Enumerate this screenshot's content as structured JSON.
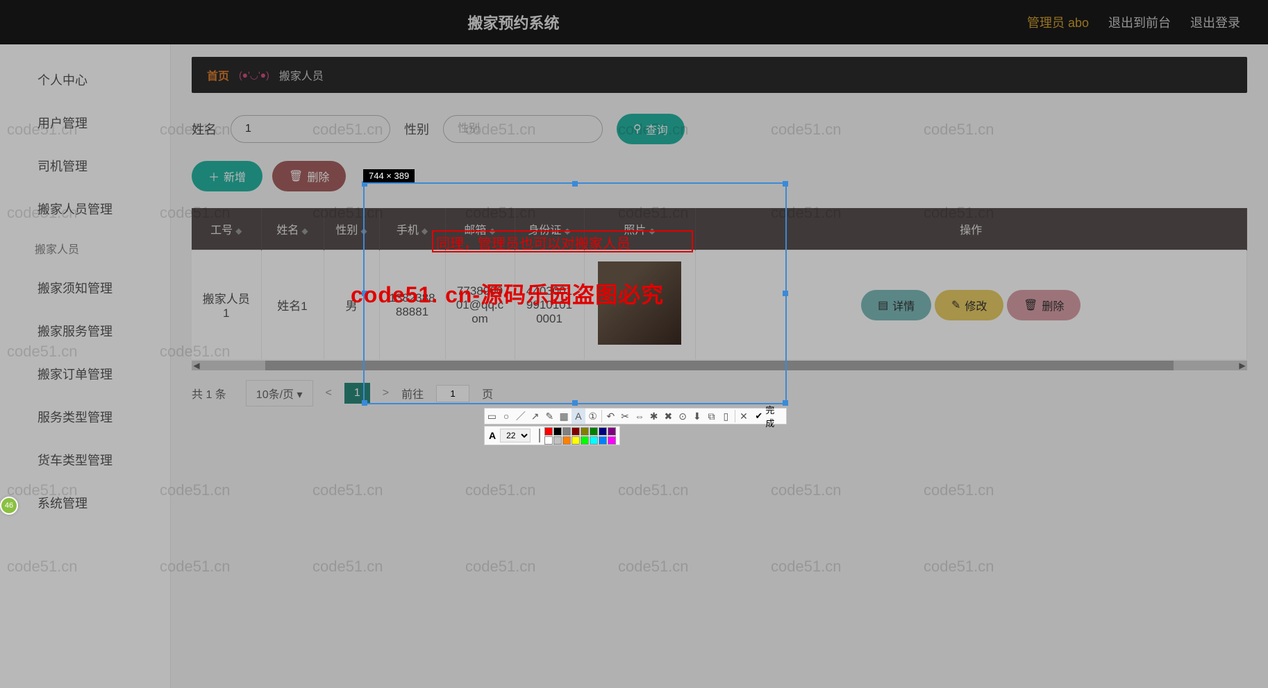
{
  "topbar": {
    "title": "搬家预约系统",
    "admin_label": "管理员 abo",
    "front_label": "退出到前台",
    "logout_label": "退出登录"
  },
  "sidebar": {
    "items": [
      {
        "label": "个人中心"
      },
      {
        "label": "用户管理"
      },
      {
        "label": "司机管理"
      },
      {
        "label": "搬家人员管理"
      },
      {
        "label": "搬家须知管理"
      },
      {
        "label": "搬家服务管理"
      },
      {
        "label": "搬家订单管理"
      },
      {
        "label": "服务类型管理"
      },
      {
        "label": "货车类型管理"
      },
      {
        "label": "系统管理"
      }
    ],
    "sub_label": "搬家人员"
  },
  "breadcrumb": {
    "home": "首页",
    "face": "(●'◡'●)",
    "current": "搬家人员"
  },
  "filter": {
    "name_label": "姓名",
    "name_value": "1",
    "gender_label": "性别",
    "gender_placeholder": "性别",
    "search_label": "查询"
  },
  "actions": {
    "add_label": "新增",
    "delete_label": "删除"
  },
  "table": {
    "headers": [
      "工号",
      "姓名",
      "性别",
      "手机",
      "邮箱",
      "身份证",
      "照片",
      "操作"
    ],
    "rows": [
      {
        "id": "搬家人员1",
        "name": "姓名1",
        "gender": "男",
        "phone": "138238888881",
        "email": "773890001@qq.com",
        "idcard": "440300199101010001",
        "detail_label": "详情",
        "edit_label": "修改",
        "delete_label": "删除"
      }
    ]
  },
  "pager": {
    "total_text": "共 1 条",
    "page_size_text": "10条/页",
    "prev": "<",
    "page": "1",
    "next": ">",
    "goto_text": "前往",
    "page_suffix": "页",
    "goto_value": "1"
  },
  "screenshot": {
    "dim_label": "744 × 389",
    "annotation1": "同理，管理员也可以对搬家人员",
    "annotation2": "code51. cn-源码乐园盗图必究",
    "done_label": "完成",
    "font_size": "22"
  },
  "watermark_text": "code51.cn",
  "badge": "46",
  "colors": {
    "palette": [
      "#ff0000",
      "#000000",
      "#808080",
      "#800000",
      "#808000",
      "#008000",
      "#000080",
      "#800080",
      "#ffffff",
      "#c0c0c0",
      "#ff8000",
      "#ffff00",
      "#00ff00",
      "#00ffff",
      "#0080ff",
      "#ff00ff"
    ]
  }
}
